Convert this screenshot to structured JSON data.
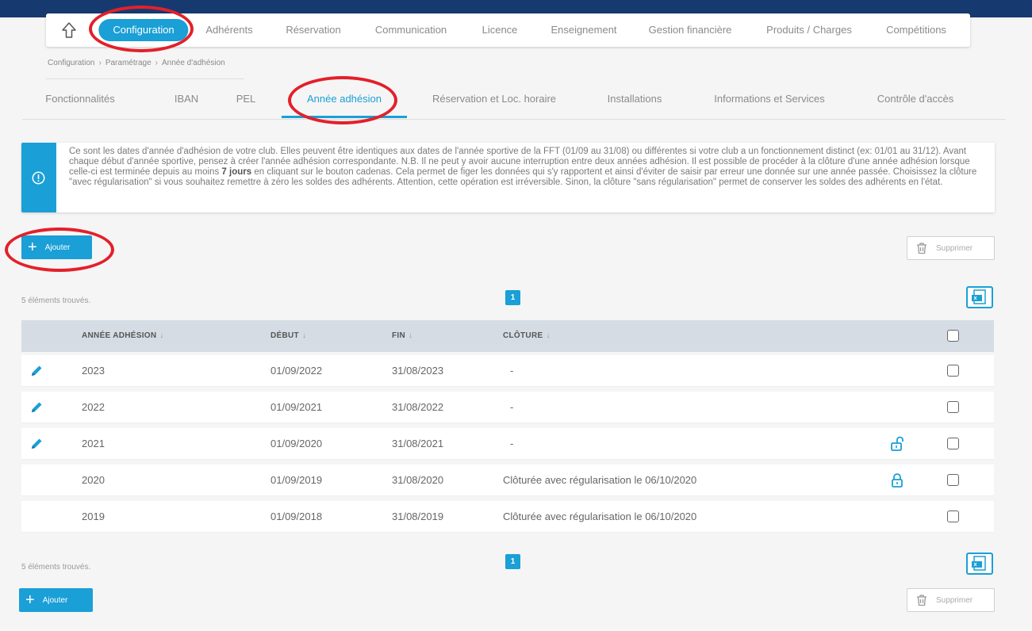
{
  "colors": {
    "accent": "#1a9fd6",
    "top_band": "#163a70",
    "annotation": "#e3202a"
  },
  "nav": {
    "home_icon": "up-arrow-icon",
    "tabs": [
      "Configuration",
      "Adhérents",
      "Réservation",
      "Communication",
      "Licence",
      "Enseignement",
      "Gestion financière",
      "Produits / Charges",
      "Compétitions"
    ],
    "active": "Configuration"
  },
  "breadcrumb": [
    "Configuration",
    "Paramétrage",
    "Année d'adhésion"
  ],
  "breadcrumb_sep": "›",
  "subtabs": [
    "Fonctionnalités",
    "IBAN",
    "PEL",
    "Année adhésion",
    "Réservation et Loc. horaire",
    "Installations",
    "Informations et Services",
    "Contrôle d'accès"
  ],
  "subtab_active": "Année adhésion",
  "info": {
    "icon": "exclamation-circle-icon",
    "text_before": "Ce sont les dates d'année d'adhésion de votre club. Elles peuvent être identiques aux dates de l'année sportive de la FFT (01/09 au 31/08) ou différentes si votre club a un fonctionnement distinct (ex: 01/01 au 31/12). Avant chaque début d'année sportive, pensez à créer l'année adhésion correspondante. N.B. Il ne peut y avoir aucune interruption entre deux années adhésion. Il est possible de procéder à la clôture d'une année adhésion lorsque celle-ci est terminée depuis au moins",
    "text_bold": "7 jours",
    "text_after": "en cliquant sur le bouton cadenas. Cela permet de figer les données qui s'y rapportent et ainsi d'éviter de saisir par erreur une donnée sur une année passée. Choisissez la clôture \"avec régularisation\" si vous souhaitez remettre à zéro les soldes des adhérents. Attention, cette opération est irréversible. Sinon, la clôture \"sans régularisation\" permet de conserver les soldes des adhérents en l'état."
  },
  "actions": {
    "add_icon": "+",
    "add_label": "Ajouter",
    "delete_label": "Supprimer",
    "delete_icon": "trash-icon",
    "export_icon": "excel-export-icon"
  },
  "list": {
    "found_label": "5 éléments trouvés.",
    "page": "1",
    "sort_arrow": "↓",
    "columns": [
      "ANNÉE ADHÉSION",
      "DÉBUT",
      "FIN",
      "CLÔTURE"
    ],
    "rows": [
      {
        "year": "2023",
        "start": "01/09/2022",
        "end": "31/08/2023",
        "closure": "-",
        "editable": true,
        "lock": ""
      },
      {
        "year": "2022",
        "start": "01/09/2021",
        "end": "31/08/2022",
        "closure": "-",
        "editable": true,
        "lock": ""
      },
      {
        "year": "2021",
        "start": "01/09/2020",
        "end": "31/08/2021",
        "closure": "-",
        "editable": true,
        "lock": "unlocked-padlock-icon"
      },
      {
        "year": "2020",
        "start": "01/09/2019",
        "end": "31/08/2020",
        "closure": "Clôturée avec régularisation le 06/10/2020",
        "editable": false,
        "lock": "locked-padlock-icon"
      },
      {
        "year": "2019",
        "start": "01/09/2018",
        "end": "31/08/2019",
        "closure": "Clôturée avec régularisation le 06/10/2020",
        "editable": false,
        "lock": ""
      }
    ]
  }
}
